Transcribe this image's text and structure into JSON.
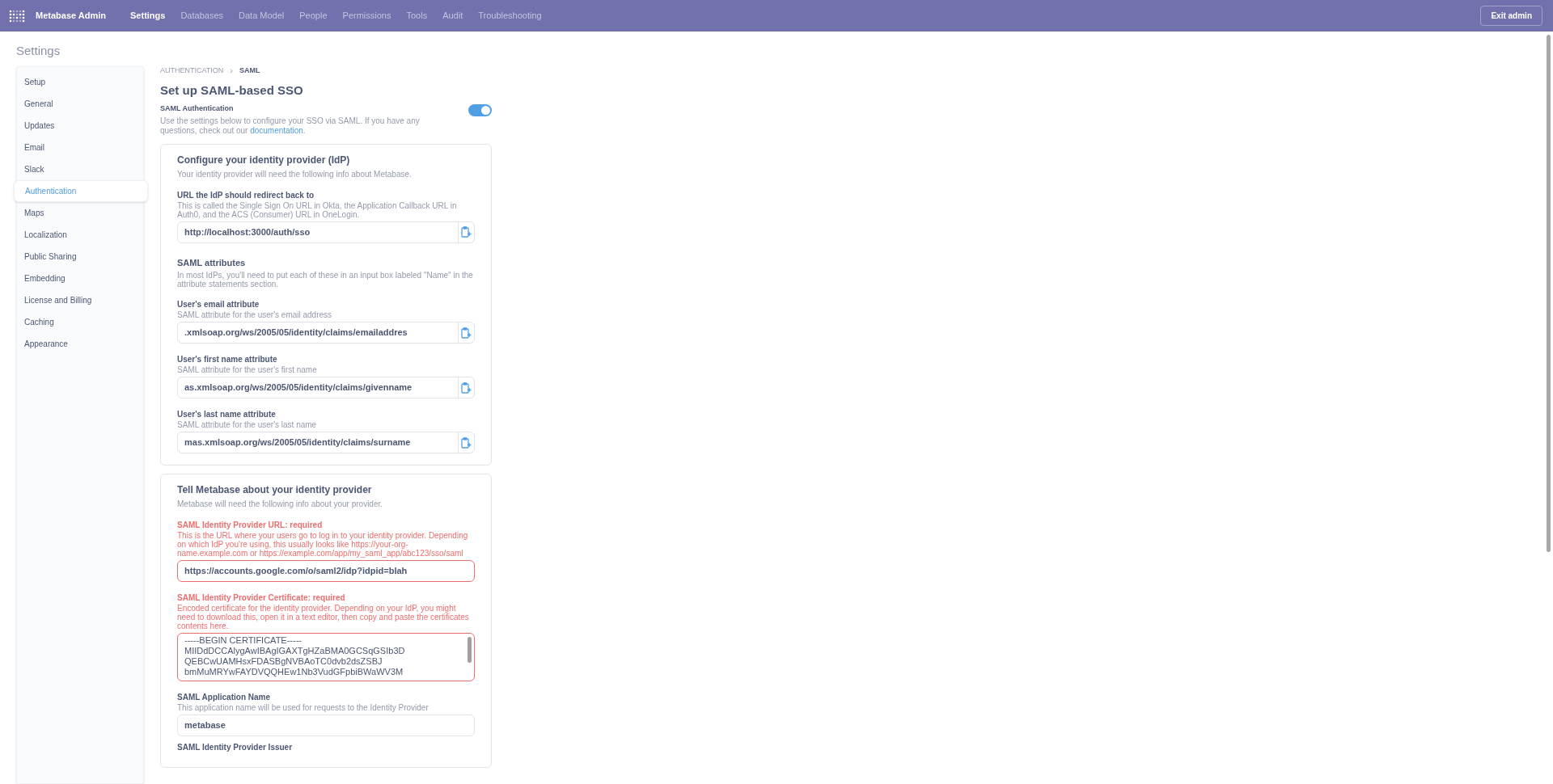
{
  "app_title": "Metabase Admin",
  "nav": [
    {
      "label": "Settings",
      "selected": true
    },
    {
      "label": "Databases",
      "selected": false
    },
    {
      "label": "Data Model",
      "selected": false
    },
    {
      "label": "People",
      "selected": false
    },
    {
      "label": "Permissions",
      "selected": false
    },
    {
      "label": "Tools",
      "selected": false
    },
    {
      "label": "Audit",
      "selected": false
    },
    {
      "label": "Troubleshooting",
      "selected": false
    }
  ],
  "exit_button": "Exit admin",
  "page_title": "Settings",
  "sidebar": {
    "items": [
      {
        "label": "Setup",
        "selected": false
      },
      {
        "label": "General",
        "selected": false
      },
      {
        "label": "Updates",
        "selected": false
      },
      {
        "label": "Email",
        "selected": false
      },
      {
        "label": "Slack",
        "selected": false
      },
      {
        "label": "Authentication",
        "selected": true
      },
      {
        "label": "Maps",
        "selected": false
      },
      {
        "label": "Localization",
        "selected": false
      },
      {
        "label": "Public Sharing",
        "selected": false
      },
      {
        "label": "Embedding",
        "selected": false
      },
      {
        "label": "License and Billing",
        "selected": false
      },
      {
        "label": "Caching",
        "selected": false
      },
      {
        "label": "Appearance",
        "selected": false
      }
    ]
  },
  "breadcrumb": {
    "parent": "AUTHENTICATION",
    "separator": "›",
    "current": "SAML"
  },
  "heading": "Set up SAML-based SSO",
  "saml_toggle": {
    "label": "SAML Authentication",
    "description": "Use the settings below to configure your SSO via SAML. If you have any questions, check out our",
    "link": "documentation",
    "after_link": ".",
    "on": true
  },
  "cards": [
    {
      "title": "Configure your identity provider (IdP)",
      "subtitle": "Your identity provider will need the following info about Metabase.",
      "sections": [
        {
          "kind": "field",
          "label": "URL the IdP should redirect back to",
          "hint": "This is called the Single Sign On URL in Okta, the Application Callback URL in Auth0, and the ACS (Consumer) URL in OneLogin.",
          "value": "http://localhost:3000/auth/sso",
          "copy": true,
          "error": false
        },
        {
          "kind": "heading",
          "title": "SAML attributes",
          "hint": "In most IdPs, you'll need to put each of these in an input box labeled \"Name\" in the attribute statements section."
        },
        {
          "kind": "field",
          "label": "User's email attribute",
          "hint": "SAML attribute for the user's email address",
          "value": ".xmlsoap.org/ws/2005/05/identity/claims/emailaddres",
          "copy": true,
          "error": false
        },
        {
          "kind": "field",
          "label": "User's first name attribute",
          "hint": "SAML attribute for the user's first name",
          "value": "as.xmlsoap.org/ws/2005/05/identity/claims/givenname",
          "copy": true,
          "error": false
        },
        {
          "kind": "field",
          "label": "User's last name attribute",
          "hint": "SAML attribute for the user's last name",
          "value": "mas.xmlsoap.org/ws/2005/05/identity/claims/surname",
          "copy": true,
          "error": false
        }
      ]
    },
    {
      "title": "Tell Metabase about your identity provider",
      "subtitle": "Metabase will need the following info about your provider.",
      "sections": [
        {
          "kind": "field",
          "label": "SAML Identity Provider URL: required",
          "hint": "This is the URL where your users go to log in to your identity provider. Depending on which IdP you're using, this usually looks like https://your-org-name.example.com or https://example.com/app/my_saml_app/abc123/sso/saml",
          "value": "https://accounts.google.com/o/saml2/idp?idpid=blah",
          "copy": false,
          "error": true
        },
        {
          "kind": "textarea",
          "label": "SAML Identity Provider Certificate: required",
          "hint": "Encoded certificate for the identity provider. Depending on your IdP, you might need to download this, open it in a text editor, then copy and paste the certificates contents here.",
          "lines": [
            "-----BEGIN CERTIFICATE-----",
            "MIIDdDCCAlygAwIBAgIGAXTgHZaBMA0GCSqGSIb3D",
            "QEBCwUAMHsxFDASBgNVBAoTC0dvb2dsZSBJ",
            "bmMuMRYwFAYDVQQHEw1Nb3VudGFpbiBWaWV3M"
          ],
          "error": true
        },
        {
          "kind": "field",
          "label": "SAML Application Name",
          "hint": "This application name will be used for requests to the Identity Provider",
          "value": "metabase",
          "copy": false,
          "error": false
        },
        {
          "kind": "label",
          "label": "SAML Identity Provider Issuer"
        }
      ]
    }
  ]
}
